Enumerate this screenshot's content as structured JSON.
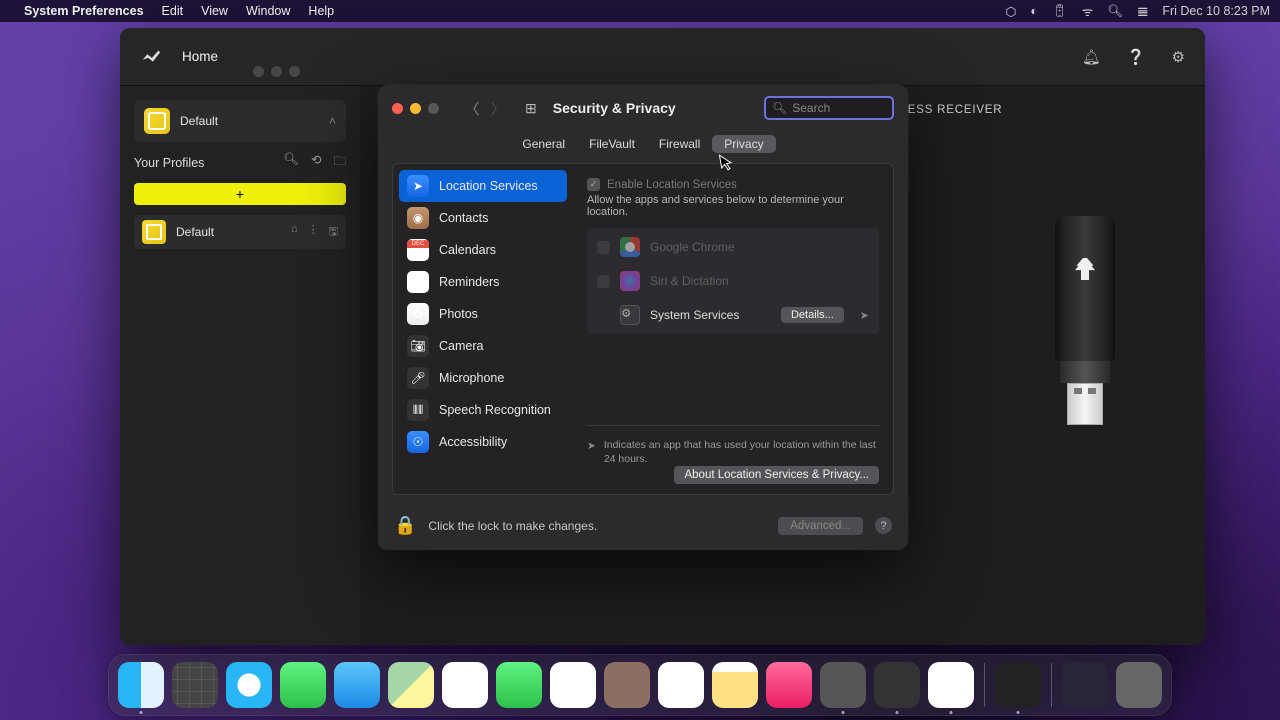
{
  "menubar": {
    "app": "System Preferences",
    "items": [
      "Edit",
      "View",
      "Window",
      "Help"
    ],
    "clock": "Fri Dec 10  8:23 PM"
  },
  "bgapp": {
    "home": "Home",
    "default_pill": "Default",
    "your_profiles": "Your Profiles",
    "add": "+",
    "profile_row": "Default",
    "receiver": "SLIPSTREAM WIRELESS RECEIVER"
  },
  "sysp": {
    "title": "Security & Privacy",
    "search_placeholder": "Search",
    "tabs": [
      "General",
      "FileVault",
      "Firewall",
      "Privacy"
    ],
    "active_tab": 3,
    "categories": [
      "Location Services",
      "Contacts",
      "Calendars",
      "Reminders",
      "Photos",
      "Camera",
      "Microphone",
      "Speech Recognition",
      "Accessibility"
    ],
    "enable_ls": "Enable Location Services",
    "allow_text": "Allow the apps and services below to determine your location.",
    "apps": {
      "chrome": "Google Chrome",
      "siri": "Siri & Dictation",
      "system": "System Services",
      "details": "Details..."
    },
    "note": "Indicates an app that has used your location within the last 24 hours.",
    "about": "About Location Services & Privacy...",
    "lock_text": "Click the lock to make changes.",
    "advanced": "Advanced..."
  }
}
